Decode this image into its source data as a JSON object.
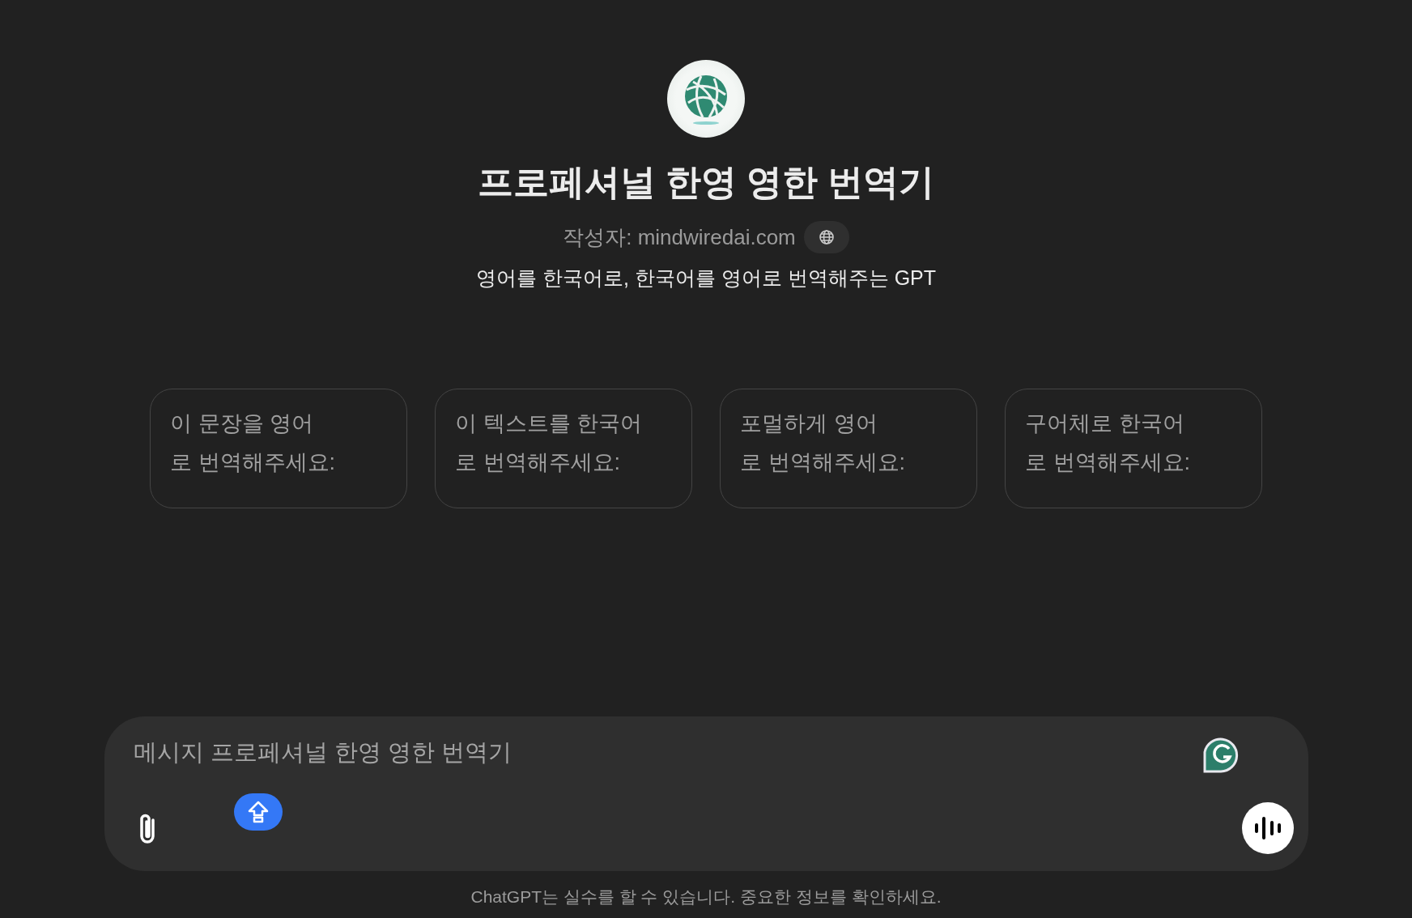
{
  "gpt": {
    "title": "프로페셔널 한영 영한 번역기",
    "author": "작성자: mindwiredai.com",
    "description": "영어를 한국어로, 한국어를 영어로 번역해주는 GPT"
  },
  "suggestions": [
    {
      "line_1": "이 문장을 영어",
      "line_2": "로 번역해주세요:"
    },
    {
      "line_1": "이 텍스트를 한국어",
      "line_2": "로 번역해주세요:"
    },
    {
      "line_1": "포멀하게 영어",
      "line_2": "로 번역해주세요:"
    },
    {
      "line_1": "구어체로 한국어",
      "line_2": "로 번역해주세요:"
    }
  ],
  "composer": {
    "placeholder": "메시지 프로페셔널 한영 영한 번역기"
  },
  "footer": "ChatGPT는 실수를 할 수 있습니다. 중요한 정보를 확인하세요."
}
